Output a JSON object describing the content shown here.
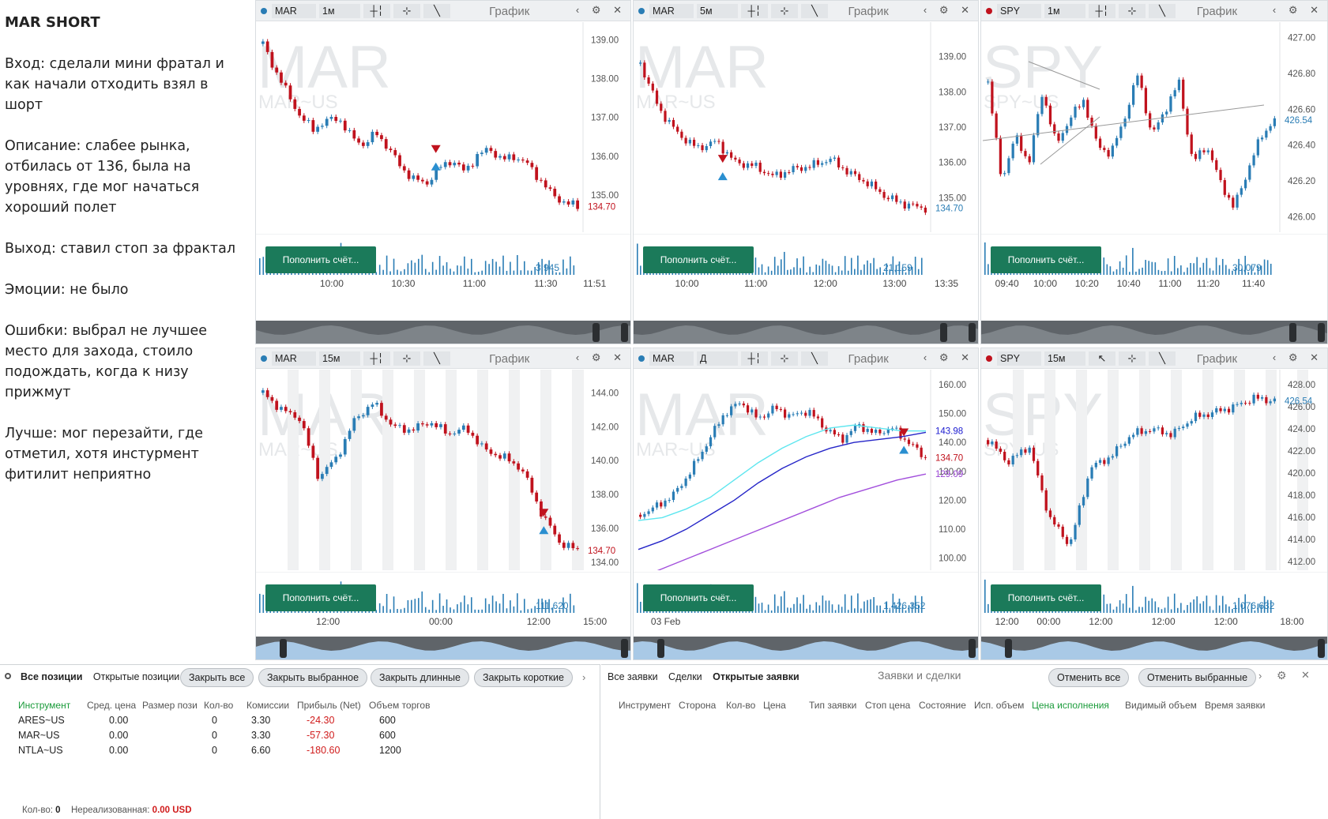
{
  "notes": {
    "title": "MAR SHORT",
    "paragraphs": [
      "Вход: сделали мини фратал и как начали отходить взял в шорт",
      "Описание: слабее рынка, отбилась от 136, была на уровнях, где мог начаться хороший полет",
      "Выход: ставил стоп за фрактал",
      "Эмоции: не было",
      "Ошибки: выбрал не лучшее место для захода, стоило подождать, когда к низу прижмут",
      "Лучше: мог перезайти, где отметил, хотя инстурмент фитилит неприятно"
    ]
  },
  "chart_label": "График",
  "deposit_label": "Пополнить счёт...",
  "colors": {
    "up": "#2a7db5",
    "down": "#c0121d",
    "deposit": "#1b7a5a"
  },
  "panels": [
    {
      "symbol": "MAR",
      "sub": "MAR~US",
      "timeframe": "1м",
      "dot": "#2a7db5",
      "ticker_icon": "bar-chart-icon",
      "y_ticks": [
        "139.00",
        "138.00",
        "137.00",
        "136.00",
        "135.00"
      ],
      "y_range": [
        134.2,
        139.3
      ],
      "last_price": "134.70",
      "last_color": "#c0121d",
      "volume": "3,945",
      "x_ticks": [
        "10:00",
        "10:30",
        "11:00",
        "11:30",
        "11:51"
      ]
    },
    {
      "symbol": "MAR",
      "sub": "MAR~US",
      "timeframe": "5м",
      "dot": "#2a7db5",
      "ticker_icon": "bar-chart-icon",
      "y_ticks": [
        "139.00",
        "138.00",
        "137.00",
        "136.00",
        "135.00"
      ],
      "y_range": [
        134.2,
        139.8
      ],
      "last_price": "134.70",
      "last_color": "#2a7db5",
      "volume": "21,159",
      "x_ticks": [
        "10:00",
        "11:00",
        "12:00",
        "13:00",
        "13:35"
      ]
    },
    {
      "symbol": "SPY",
      "sub": "SPY~US",
      "timeframe": "1м",
      "dot": "#c0121d",
      "ticker_icon": "bar-chart-icon",
      "y_ticks": [
        "427.00",
        "426.80",
        "426.60",
        "426.40",
        "426.20",
        "426.00"
      ],
      "y_range": [
        425.95,
        427.05
      ],
      "last_price": "426.54",
      "last_color": "#2a7db5",
      "volume": "30,079",
      "x_ticks": [
        "09:40",
        "10:00",
        "10:20",
        "10:40",
        "11:00",
        "11:20",
        "11:40"
      ]
    },
    {
      "symbol": "MAR",
      "sub": "MAR~US",
      "timeframe": "15м",
      "dot": "#2a7db5",
      "ticker_icon": "bar-chart-icon",
      "y_ticks": [
        "144.00",
        "142.00",
        "140.00",
        "138.00",
        "136.00",
        "134.00"
      ],
      "y_range": [
        133.9,
        145.0
      ],
      "last_price": "134.70",
      "last_color": "#c0121d",
      "volume": "111,620",
      "x_ticks": [
        "12:00",
        "00:00",
        "12:00",
        "15:00"
      ]
    },
    {
      "symbol": "MAR",
      "sub": "MAR~US",
      "timeframe": "Д",
      "dot": "#2a7db5",
      "ticker_icon": "bar-chart-icon",
      "y_ticks": [
        "160.00",
        "150.00",
        "140.00",
        "130.00",
        "120.00",
        "110.00",
        "100.00"
      ],
      "y_range": [
        98,
        163
      ],
      "last_price": "134.70",
      "last_color": "#c0121d",
      "extra_prices": [
        {
          "v": "143.98",
          "c": "#1a1ad0"
        },
        {
          "v": "129.09",
          "c": "#9b45d6"
        }
      ],
      "volume": "1,426,352",
      "x_ticks": [
        "03 Feb"
      ]
    },
    {
      "symbol": "SPY",
      "sub": "SPY~US",
      "timeframe": "15м",
      "dot": "#c0121d",
      "ticker_icon": "cursor-icon",
      "y_ticks": [
        "428.00",
        "426.00",
        "424.00",
        "422.00",
        "420.00",
        "418.00",
        "416.00",
        "414.00",
        "412.00"
      ],
      "y_range": [
        411.8,
        428.8
      ],
      "last_price": "426.54",
      "last_color": "#2a7db5",
      "volume": "1,076,632",
      "x_ticks": [
        "12:00",
        "00:00",
        "12:00",
        "12:00",
        "12:00",
        "18:00"
      ]
    }
  ],
  "positions": {
    "tabs": [
      "Все позиции",
      "Открытые позиции"
    ],
    "buttons": [
      "Закрыть все",
      "Закрыть выбранное",
      "Закрыть длинные",
      "Закрыть короткие"
    ],
    "columns": [
      "Инструмент",
      "Сред. цена",
      "Размер пози",
      "Кол-во",
      "Комиссии",
      "Прибыль (Net)",
      "Объем торгов"
    ],
    "rows": [
      [
        "ARES~US",
        "0.00",
        "0",
        "3.30",
        "-24.30",
        "600"
      ],
      [
        "MAR~US",
        "0.00",
        "0",
        "3.30",
        "-57.30",
        "600"
      ],
      [
        "NTLA~US",
        "0.00",
        "0",
        "6.60",
        "-180.60",
        "1200"
      ]
    ],
    "footer_count_label": "Кол-во:",
    "footer_count": "0",
    "footer_unreal_label": "Нереализованная:",
    "footer_unreal": "0.00 USD"
  },
  "orders": {
    "tabs": [
      "Все заявки",
      "Сделки",
      "Открытые заявки"
    ],
    "title": "Заявки и сделки",
    "buttons": [
      "Отменить все",
      "Отменить выбранные"
    ],
    "columns": [
      "Инструмент",
      "Сторона",
      "Кол-во",
      "Цена",
      "Тип заявки",
      "Стоп цена",
      "Состояние",
      "Исп. объем",
      "Цена исполнения",
      "Видимый объем",
      "Время заявки"
    ]
  }
}
